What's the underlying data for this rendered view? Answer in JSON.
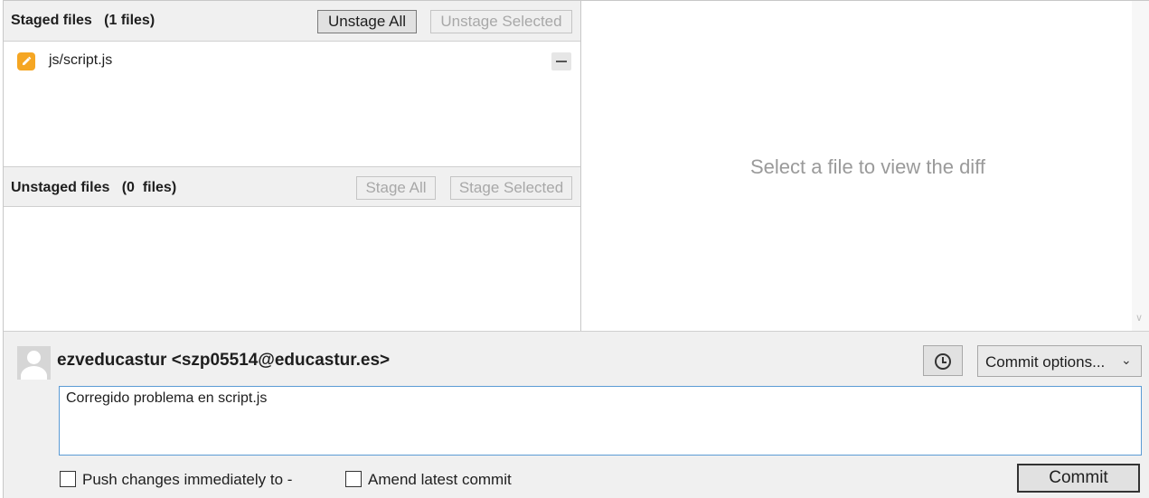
{
  "staged": {
    "title": "Staged files   (1 files)",
    "unstage_all_label": "Unstage All",
    "unstage_selected_label": "Unstage Selected",
    "files": [
      {
        "name": "js/script.js",
        "status_icon": "pencil-icon"
      }
    ]
  },
  "unstaged": {
    "title": "Unstaged files   (0  files)",
    "stage_all_label": "Stage All",
    "stage_selected_label": "Stage Selected",
    "files": []
  },
  "diff": {
    "placeholder": "Select a file to view the diff"
  },
  "commit": {
    "author": "ezveducastur <szp05514@educastur.es>",
    "history_icon": "clock-icon",
    "options_label": "Commit options...",
    "message": "Corregido problema en script.js",
    "push_label": "Push changes immediately to -",
    "push_checked": false,
    "amend_label": "Amend latest commit",
    "amend_checked": false,
    "commit_label": "Commit"
  },
  "colors": {
    "file_icon": "#f5a623",
    "focus_border": "#5b9bd5",
    "panel_bg": "#f0f0f0"
  }
}
